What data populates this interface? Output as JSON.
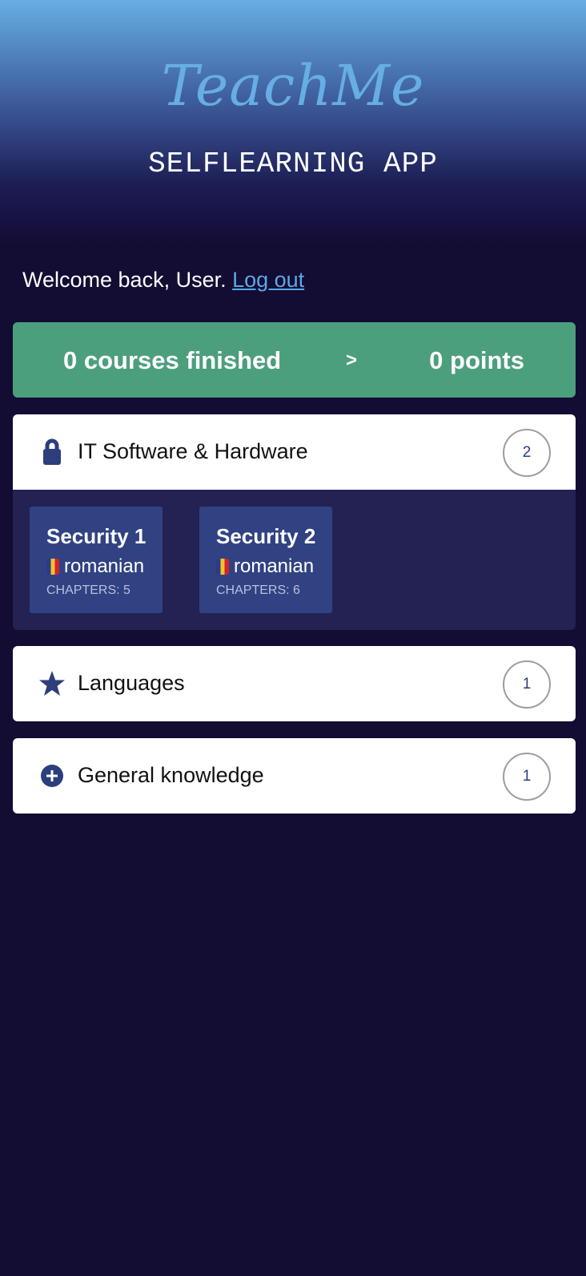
{
  "header": {
    "logo": "TeachMe",
    "subtitle": "SELFLEARNING APP"
  },
  "welcome": {
    "text": "Welcome back, User. ",
    "logout": "Log out"
  },
  "stats": {
    "courses": "0 courses finished",
    "arrow": ">",
    "points": "0 points",
    "color": "#4c9f7d"
  },
  "categories": [
    {
      "label": "IT Software & Hardware",
      "count": "2",
      "icon": "lock-icon",
      "courses": [
        {
          "title": "Security 1",
          "language": "romanian",
          "chapters": "CHAPTERS: 5"
        },
        {
          "title": "Security 2",
          "language": "romanian",
          "chapters": "CHAPTERS: 6"
        }
      ]
    },
    {
      "label": "Languages",
      "count": "1",
      "icon": "star-icon"
    },
    {
      "label": "General knowledge",
      "count": "1",
      "icon": "plus-circle-icon"
    }
  ],
  "colors": {
    "background": "#130c33",
    "accent": "#66aee4",
    "icon": "#2c3e7c",
    "course_card": "#314283"
  }
}
